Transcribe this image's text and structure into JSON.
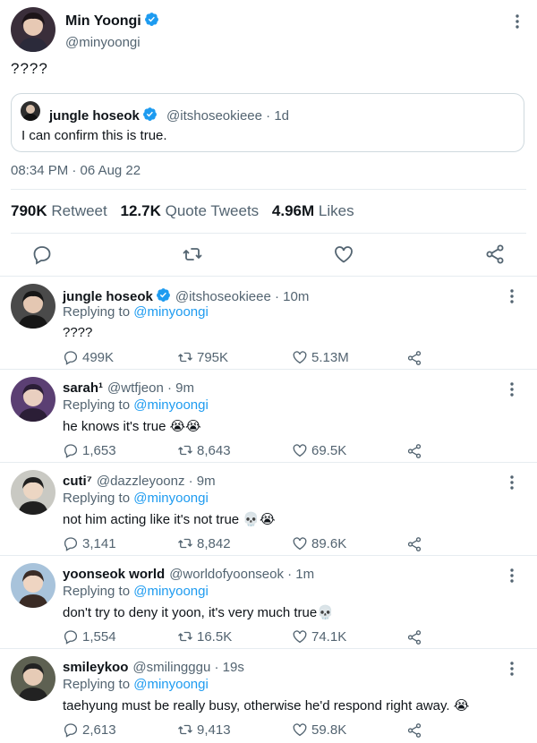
{
  "main_tweet": {
    "name": "Min Yoongi",
    "handle": "@minyoongi",
    "text": "????",
    "timestamp": "08:34 PM · 06 Aug 22",
    "quote": {
      "name": "jungle hoseok",
      "handle_time": "@itshoseokieee · 1d",
      "text": "I can confirm this is true."
    },
    "stats": {
      "retweets_value": "790K",
      "retweets_label": "Retweet",
      "quotes_value": "12.7K",
      "quotes_label": "Quote Tweets",
      "likes_value": "4.96M",
      "likes_label": "Likes"
    }
  },
  "replying_to_label": "Replying to ",
  "replies": [
    {
      "name": "jungle hoseok",
      "handle_time": "@itshoseokieee · 10m",
      "mention": "@minyoongi",
      "text": "????",
      "replies": "499K",
      "retweets": "795K",
      "likes": "5.13M",
      "verified": true
    },
    {
      "name": "sarah¹",
      "handle_time": "@wtfjeon · 9m",
      "mention": "@minyoongi",
      "text": "he knows it's true 😭😭",
      "replies": "1,653",
      "retweets": "8,643",
      "likes": "69.5K",
      "verified": false
    },
    {
      "name": "cuti⁷",
      "handle_time": "@dazzleyoonz · 9m",
      "mention": "@minyoongi",
      "text": "not him acting like it's not true 💀😭",
      "replies": "3,141",
      "retweets": "8,842",
      "likes": "89.6K",
      "verified": false
    },
    {
      "name": "yoonseok world",
      "handle_time": "@worldofyoonseok · 1m",
      "mention": "@minyoongi",
      "text": "don't try to deny it yoon, it's very much true💀",
      "replies": "1,554",
      "retweets": "16.5K",
      "likes": "74.1K",
      "verified": false
    },
    {
      "name": "smileykoo",
      "handle_time": "@smilingggu · 19s",
      "mention": "@minyoongi",
      "text": "taehyung must be really busy, otherwise he'd respond right away. 😭",
      "replies": "2,613",
      "retweets": "9,413",
      "likes": "59.8K",
      "verified": false
    }
  ],
  "colors": {
    "accent": "#1d9bf0",
    "muted": "#536471",
    "text": "#0f1419",
    "border": "#e6ecf0"
  },
  "icons": [
    "verified-badge-icon",
    "more-icon",
    "reply-icon",
    "retweet-icon",
    "like-icon",
    "share-icon"
  ]
}
